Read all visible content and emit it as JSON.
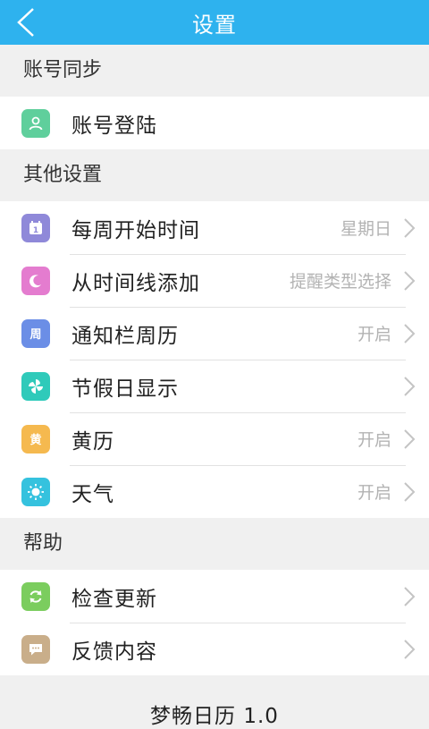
{
  "header": {
    "title": "设置"
  },
  "sections": [
    {
      "title": "账号同步",
      "items": [
        {
          "label": "账号登陆",
          "value": "",
          "icon": "user-icon",
          "color": "#5fcf9c"
        }
      ]
    },
    {
      "title": "其他设置",
      "items": [
        {
          "label": "每周开始时间",
          "value": "星期日",
          "icon": "calendar-icon",
          "color": "#8f89d9"
        },
        {
          "label": "从时间线添加",
          "value": "提醒类型选择",
          "icon": "moon-icon",
          "color": "#e47ccf"
        },
        {
          "label": "通知栏周历",
          "value": "开启",
          "icon": "week-icon",
          "icon_text": "周",
          "color": "#6b8ee6"
        },
        {
          "label": "节假日显示",
          "value": "",
          "icon": "pinwheel-icon",
          "color": "#2fcaba"
        },
        {
          "label": "黄历",
          "value": "开启",
          "icon": "almanac-icon",
          "icon_text": "黄",
          "color": "#f5b94f"
        },
        {
          "label": "天气",
          "value": "开启",
          "icon": "sun-icon",
          "color": "#35c2de"
        }
      ]
    },
    {
      "title": "帮助",
      "items": [
        {
          "label": "检查更新",
          "value": "",
          "icon": "refresh-icon",
          "color": "#7bcd5e"
        },
        {
          "label": "反馈内容",
          "value": "",
          "icon": "chat-bubble-icon",
          "color": "#c9ae8a"
        }
      ]
    }
  ],
  "footer": {
    "version": "梦畅日历 1.0"
  }
}
